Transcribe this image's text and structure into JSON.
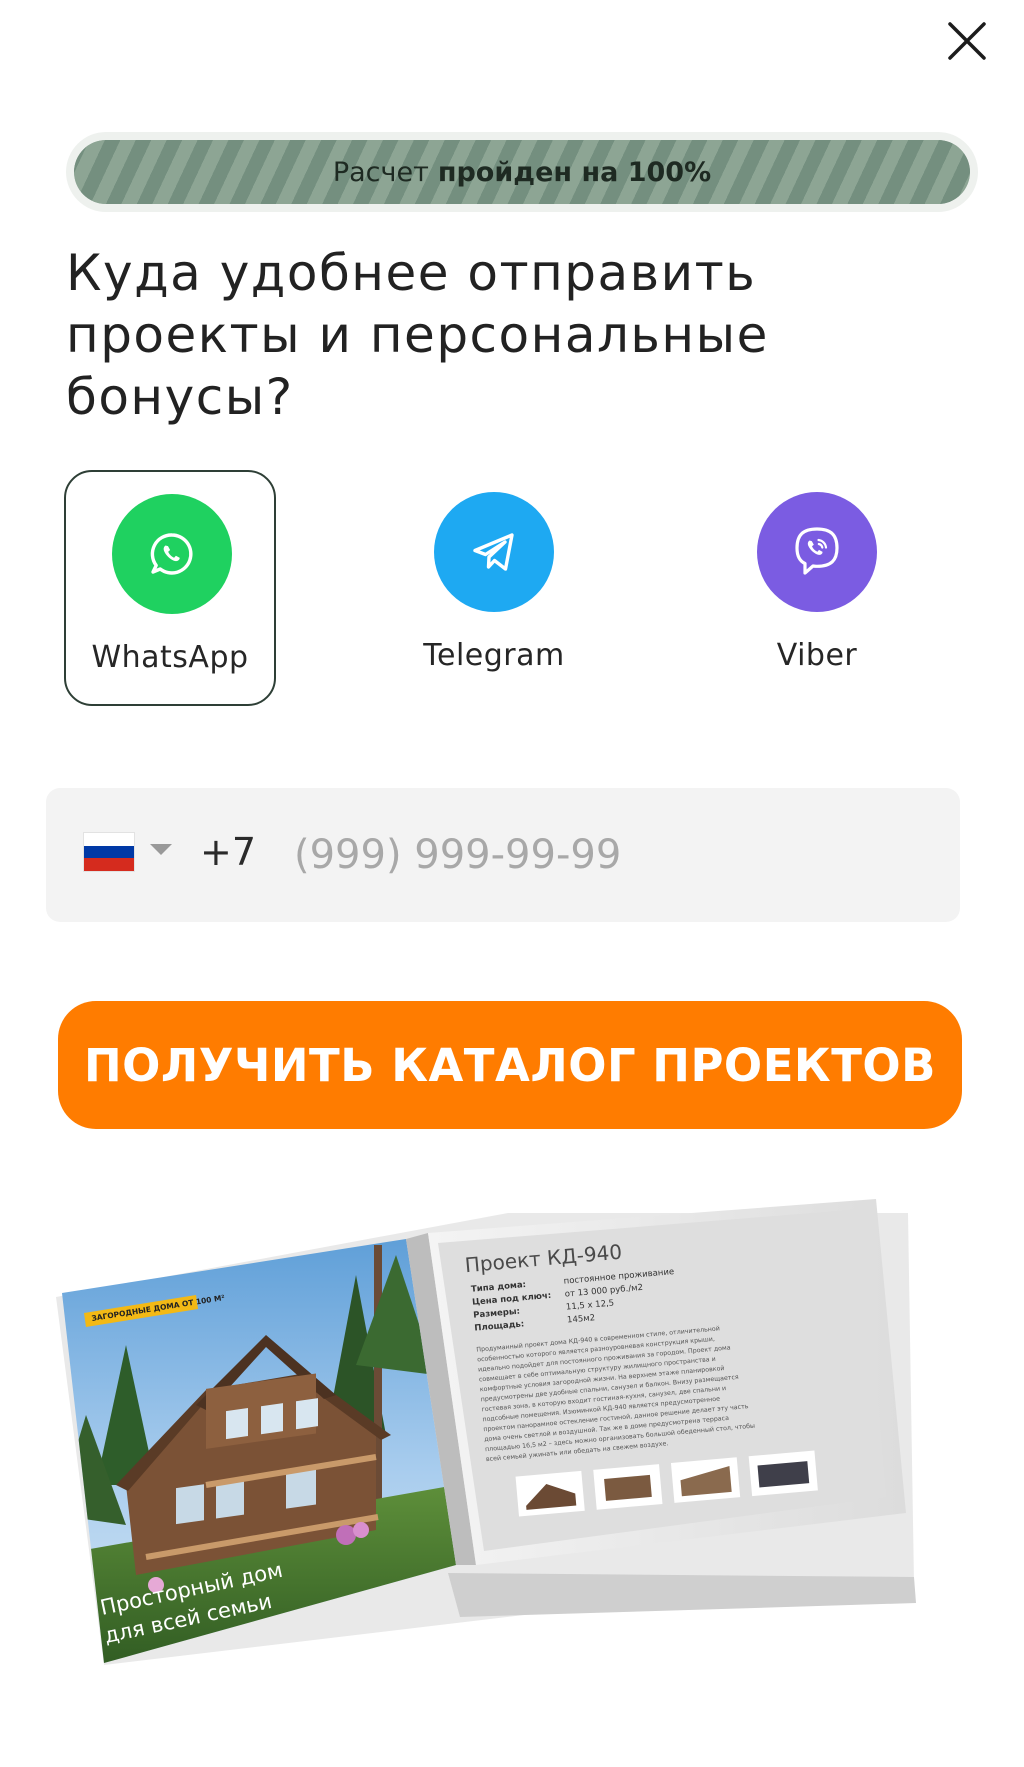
{
  "close": {
    "icon": "close-icon"
  },
  "progress": {
    "prefix": "Расчет",
    "strong": "пройден на 100%",
    "value_percent": 100
  },
  "question": {
    "lines": [
      "Куда удобнее отправить",
      "проекты и персональные",
      "бонусы?"
    ]
  },
  "messengers": [
    {
      "label": "WhatsApp",
      "icon": "whatsapp-icon",
      "color": "#1fd160",
      "selected": true
    },
    {
      "label": "Telegram",
      "icon": "telegram-icon",
      "color": "#1ea9f2",
      "selected": false
    },
    {
      "label": "Viber",
      "icon": "viber-icon",
      "color": "#7b5ce2",
      "selected": false
    }
  ],
  "phone": {
    "country": "Russia",
    "flag_colors": [
      "#ffffff",
      "#0039a6",
      "#d52b1e"
    ],
    "dial_code": "+7",
    "placeholder": "(999) 999-99-99",
    "value": ""
  },
  "cta": {
    "label": "ПОЛУЧИТЬ КАТАЛОГ ПРОЕКТОВ",
    "color": "#ff7c00"
  },
  "catalog": {
    "badge": "ЗАГОРОДНЫЕ ДОМА ОТ 100 М²",
    "cover_line1": "Просторный дом",
    "cover_line2": "для всей семьи",
    "project_title": "Проект КД-940",
    "specs": [
      {
        "k": "Типа дома:",
        "v": "постоянное проживание"
      },
      {
        "k": "Цена под ключ:",
        "v": "от 13 000 руб./м2"
      },
      {
        "k": "Размеры:",
        "v": "11,5 x 12,5"
      },
      {
        "k": "Площадь:",
        "v": "145м2"
      }
    ],
    "description": [
      "Продуманный проект дома КД-940 в современном стиле, отличительной",
      "особенностью которого является разноуровневая конструкция крыши,",
      "идеально подойдет для постоянного проживания за городом. Проект дома",
      "совмещает в себе оптимальную структуру жилищного пространства и",
      "комфортные условия загородной жизни. На верхнем этаже планировкой",
      "предусмотрены две удобные спальни, санузел и балкон. Внизу размещается",
      "гостевая зона, в которую входит гостиная-кухня, санузел, две спальни и",
      "подсобные помещения. Изюминкой КД-940 является предусмотренное",
      "проектом панорамное остекление гостиной, данное решение делает эту часть",
      "дома очень светлой и воздушной. Так же в доме предусмотрена терраса",
      "площадью 16,5 м2 – здесь можно организовать большой обеденный стол, чтобы",
      "всей семьей ужинать или обедать на свежем воздухе."
    ]
  }
}
